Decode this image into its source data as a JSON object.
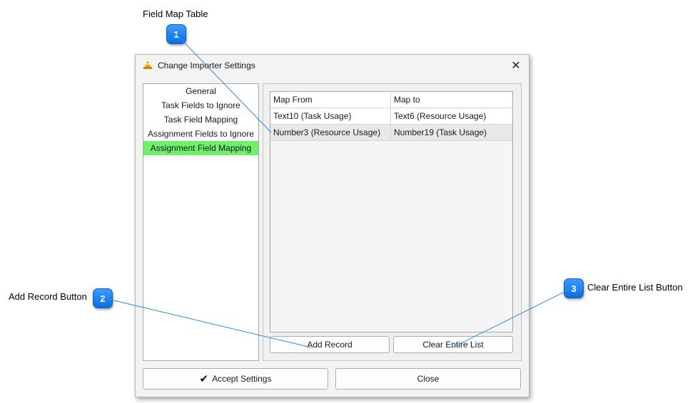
{
  "callouts": {
    "c1": {
      "number": "1",
      "label": "Field Map Table"
    },
    "c2": {
      "number": "2",
      "label": "Add Record Button"
    },
    "c3": {
      "number": "3",
      "label": "Clear Entire List Button"
    }
  },
  "dialog": {
    "title": "Change Importer Settings",
    "icon": "app-cone-icon",
    "close_glyph": "✕",
    "nav_items": [
      {
        "label": "General"
      },
      {
        "label": "Task Fields to Ignore"
      },
      {
        "label": "Task Field Mapping"
      },
      {
        "label": "Assignment Fields to Ignore"
      },
      {
        "label": "Assignment Field Mapping",
        "selected": true
      }
    ],
    "table": {
      "headers": [
        "Map From",
        "Map to"
      ],
      "rows": [
        [
          "Text10 (Task Usage)",
          "Text6 (Resource Usage)"
        ],
        [
          "Number3 (Resource Usage)",
          "Number19 (Task Usage)"
        ]
      ]
    },
    "buttons": {
      "add_record": "Add Record",
      "clear_list": "Clear Entire List",
      "accept": "Accept Settings",
      "accept_icon": "checkmark-icon",
      "close": "Close"
    }
  },
  "colors": {
    "selected_nav": "#6ef06a",
    "callout_badge": "#1a7ff0",
    "leader_line": "#2a8ae0"
  }
}
